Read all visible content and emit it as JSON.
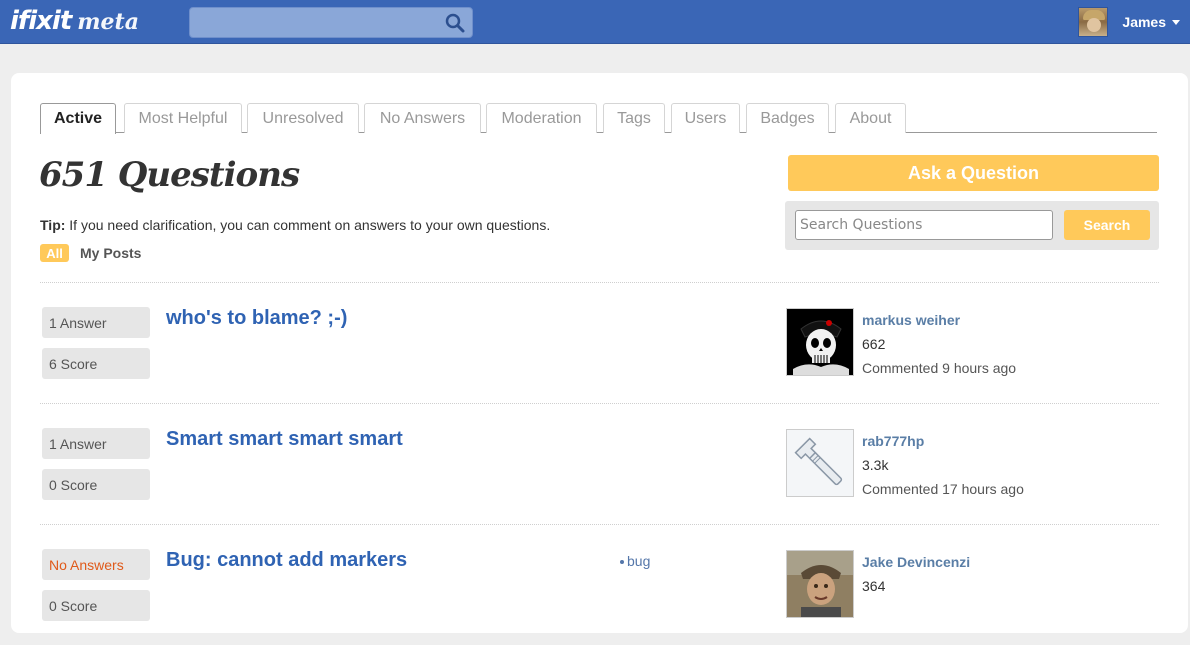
{
  "header": {
    "logo_text": "ifixit",
    "logo_sub": "meta",
    "search_placeholder": "",
    "user_name": "James"
  },
  "tabs": [
    {
      "label": "Active",
      "active": true
    },
    {
      "label": "Most Helpful"
    },
    {
      "label": "Unresolved"
    },
    {
      "label": "No Answers"
    },
    {
      "label": "Moderation"
    },
    {
      "label": "Tags"
    },
    {
      "label": "Users"
    },
    {
      "label": "Badges"
    },
    {
      "label": "About"
    }
  ],
  "main": {
    "heading": "651 Questions",
    "tip_label": "Tip:",
    "tip_text": " If you need clarification, you can comment on answers to your own questions.",
    "filter_all": "All",
    "filter_mine": "My Posts"
  },
  "sidebar": {
    "ask_button": "Ask a Question",
    "search_placeholder": "Search Questions",
    "search_button": "Search"
  },
  "questions": [
    {
      "answers": "1 Answer",
      "score": "6 Score",
      "title": "who's to blame? ;-)",
      "tag": "",
      "user": "markus weiher",
      "rep": "662",
      "when": "Commented 9 hours ago",
      "avatar": "skull-avatar"
    },
    {
      "answers": "1 Answer",
      "score": "0 Score",
      "title": "Smart smart smart smart",
      "tag": "",
      "user": "rab777hp",
      "rep": "3.3k",
      "when": "Commented 17 hours ago",
      "avatar": "wrench-avatar"
    },
    {
      "answers": "No Answers",
      "score": "0 Score",
      "title": "Bug: cannot add markers",
      "tag": "bug",
      "user": "Jake Devincenzi",
      "rep": "364",
      "when": "",
      "avatar": "photo-avatar"
    }
  ],
  "colors": {
    "header_bg": "#3a66b6",
    "accent": "#ffc95a",
    "link": "#2f63b3",
    "no_answers": "#e05a1a"
  }
}
